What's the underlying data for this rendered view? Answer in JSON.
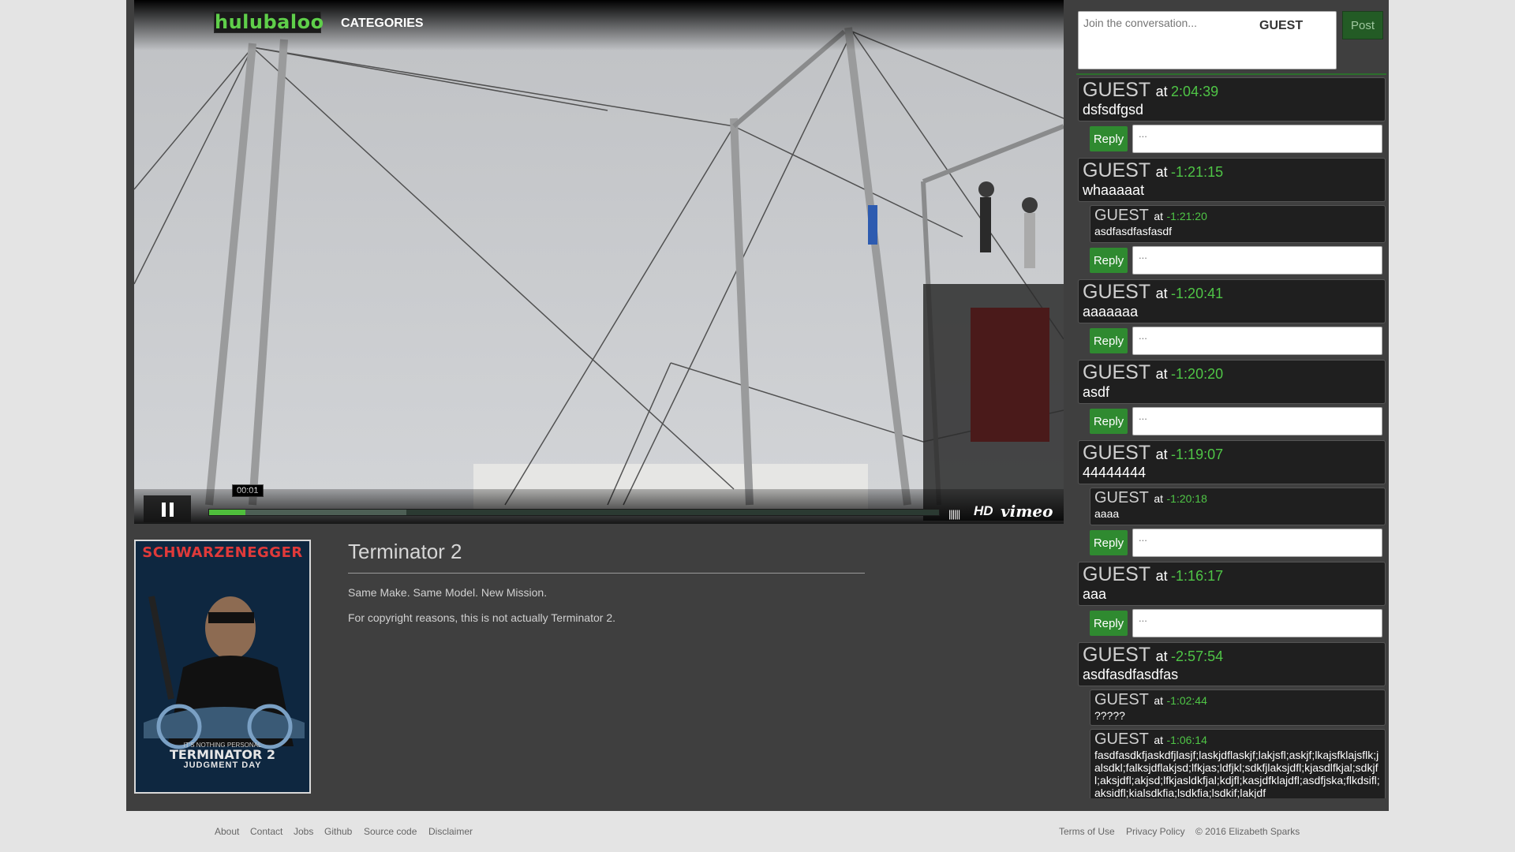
{
  "header": {
    "logo": "hulubaloo",
    "nav_categories": "CATEGORIES"
  },
  "player": {
    "time_tooltip": "00:01",
    "played_fraction": 0.05,
    "loaded_fraction": 0.27,
    "hd_label": "HD",
    "vimeo_label": "vimeo",
    "volume_glyph": "||||||"
  },
  "movie": {
    "title": "Terminator 2",
    "tagline": "Same Make. Same Model. New Mission.",
    "note": "For copyright reasons, this is not actually Terminator 2.",
    "poster": {
      "actor": "SCHWARZENEGGER",
      "tagline": "IT'S NOTHING PERSONAL",
      "title": "TERMINATOR 2",
      "subtitle": "JUDGMENT DAY"
    }
  },
  "chat": {
    "placeholder": "Join the conversation...",
    "user": "GUEST",
    "post_label": "Post",
    "reply_label": "Reply",
    "reply_placeholder": "...",
    "at_word": "at",
    "comments": [
      {
        "name": "GUEST",
        "time": "2:04:39",
        "text": "dsfsdfgsd"
      },
      {
        "name": "GUEST",
        "time": "-1:21:15",
        "text": "whaaaaat"
      },
      {
        "name": "GUEST",
        "time": "-1:21:20",
        "text": "asdfasdfasfasdf"
      },
      {
        "name": "GUEST",
        "time": "-1:20:41",
        "text": "aaaaaaa"
      },
      {
        "name": "GUEST",
        "time": "-1:20:20",
        "text": "asdf"
      },
      {
        "name": "GUEST",
        "time": "-1:19:07",
        "text": "44444444"
      },
      {
        "name": "GUEST",
        "time": "-1:20:18",
        "text": "aaaa"
      },
      {
        "name": "GUEST",
        "time": "-1:16:17",
        "text": "aaa"
      },
      {
        "name": "GUEST",
        "time": "-2:57:54",
        "text": "asdfasdfasdfas"
      },
      {
        "name": "GUEST",
        "time": "-1:02:44",
        "text": "?????"
      },
      {
        "name": "GUEST",
        "time": "-1:06:14",
        "text": "fasdfasdkfjaskdfjlasjf;laskjdflaskjf;lakjsfl;askjf;lkajsfklajsflk;jalsdkl;falksjdflakjsd;lfkjas;ldfjkl;sdkfjlaksjdfl;kjasdlfkjal;sdkjfl;aksjdfl;akjsd;lfkjasldkfjal;kdjfl;kasjdfklajdfl;asdfjska;flkdsifl;aksidfl;kialsdkfia;lsdkfia;lsdkif;lakjdf"
      }
    ]
  },
  "footer": {
    "left_links": [
      "About",
      "Contact",
      "Jobs",
      "Github",
      "Source code",
      "Disclaimer"
    ],
    "right_links": [
      "Terms of Use",
      "Privacy Policy"
    ],
    "copyright": "© 2016 Elizabeth Sparks"
  }
}
